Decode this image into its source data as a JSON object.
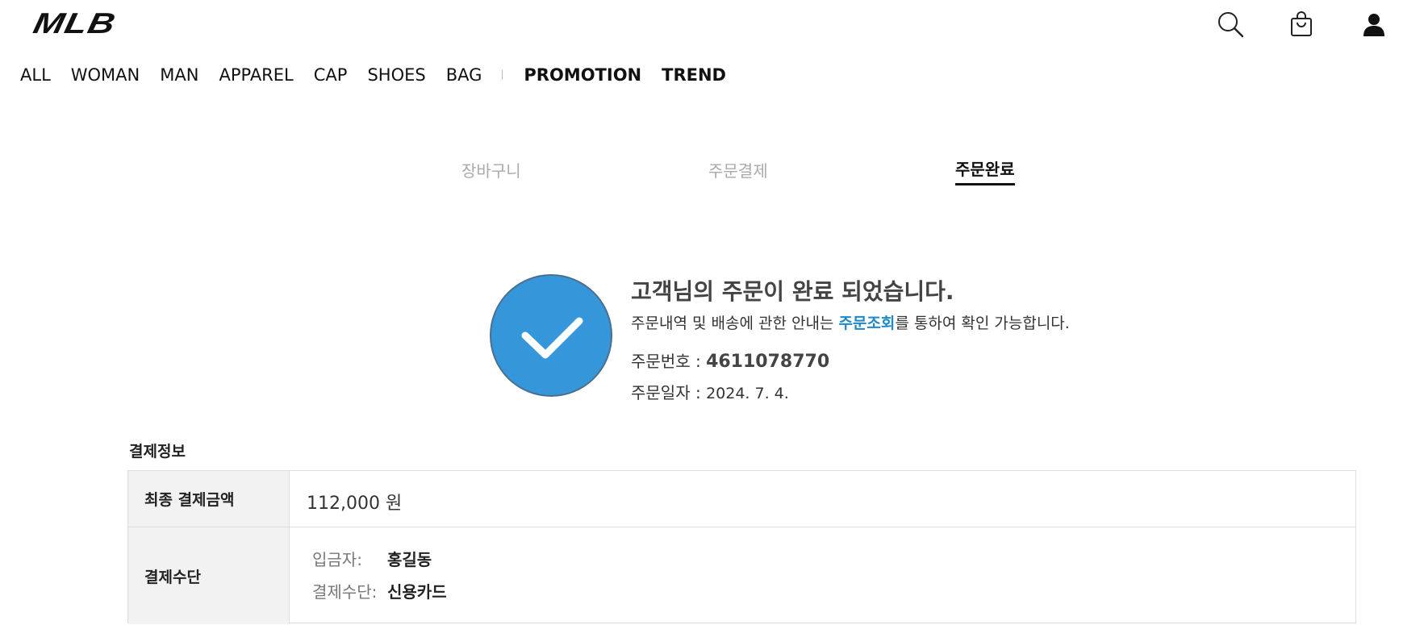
{
  "brand": {
    "logo": "MLB"
  },
  "header": {
    "icons": [
      "search-icon",
      "shopping-bag-icon",
      "user-icon"
    ]
  },
  "nav": {
    "items": [
      "ALL",
      "WOMAN",
      "MAN",
      "APPAREL",
      "CAP",
      "SHOES",
      "BAG"
    ],
    "featured": [
      "PROMOTION",
      "TREND"
    ]
  },
  "steps": [
    {
      "label": "장바구니"
    },
    {
      "label": "주문결제"
    },
    {
      "label": "주문완료"
    }
  ],
  "confirmation": {
    "title": "고객님의 주문이 완료 되었습니다.",
    "desc_prefix": "주문내역 및 배송에 관한 안내는 ",
    "desc_link": "주문조회",
    "desc_suffix": "를 통하여 확인 가능합니다.",
    "order_no_label": "주문번호 : ",
    "order_no": "4611078770",
    "order_date_label": "주문일자 : ",
    "order_date": "2024. 7. 4."
  },
  "payment": {
    "section_title": "결제정보",
    "total_label": "최종 결제금액",
    "total_value": "112,000 원",
    "method_label": "결제수단",
    "depositor_label": "입금자:",
    "depositor_value": "홍길동",
    "method_key": "결제수단:",
    "method_value": "신용카드"
  },
  "colors": {
    "accent": "#3597d9",
    "link": "#1e88c9",
    "inactive_step": "#aaaaaa"
  }
}
